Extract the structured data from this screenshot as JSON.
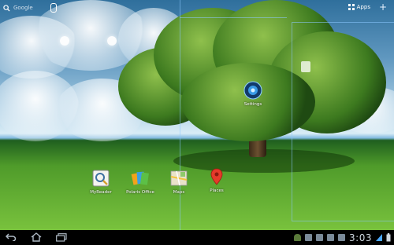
{
  "top_bar": {
    "search_label": "Google",
    "apps_label": "Apps"
  },
  "desktop_icons": [
    {
      "label": "Settings",
      "icon": "settings-icon"
    },
    {
      "label": "MyReader",
      "icon": "myreader-icon"
    },
    {
      "label": "Polaris Office",
      "icon": "polaris-office-icon"
    },
    {
      "label": "Maps",
      "icon": "maps-icon"
    },
    {
      "label": "Places",
      "icon": "places-icon"
    }
  ],
  "nav": {
    "clock": "3:03"
  },
  "colors": {
    "navbar": "#000000",
    "clock": "#cfd8e0",
    "accent": "#4aa8ff"
  }
}
